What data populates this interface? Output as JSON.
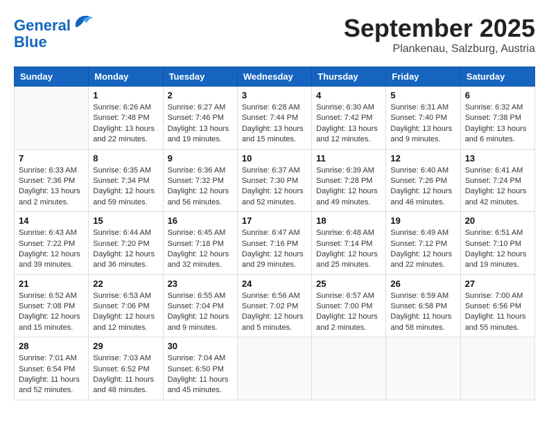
{
  "header": {
    "logo_line1": "General",
    "logo_line2": "Blue",
    "month_title": "September 2025",
    "location": "Plankenau, Salzburg, Austria"
  },
  "weekdays": [
    "Sunday",
    "Monday",
    "Tuesday",
    "Wednesday",
    "Thursday",
    "Friday",
    "Saturday"
  ],
  "weeks": [
    [
      {
        "day": "",
        "info": ""
      },
      {
        "day": "1",
        "info": "Sunrise: 6:26 AM\nSunset: 7:48 PM\nDaylight: 13 hours\nand 22 minutes."
      },
      {
        "day": "2",
        "info": "Sunrise: 6:27 AM\nSunset: 7:46 PM\nDaylight: 13 hours\nand 19 minutes."
      },
      {
        "day": "3",
        "info": "Sunrise: 6:28 AM\nSunset: 7:44 PM\nDaylight: 13 hours\nand 15 minutes."
      },
      {
        "day": "4",
        "info": "Sunrise: 6:30 AM\nSunset: 7:42 PM\nDaylight: 13 hours\nand 12 minutes."
      },
      {
        "day": "5",
        "info": "Sunrise: 6:31 AM\nSunset: 7:40 PM\nDaylight: 13 hours\nand 9 minutes."
      },
      {
        "day": "6",
        "info": "Sunrise: 6:32 AM\nSunset: 7:38 PM\nDaylight: 13 hours\nand 6 minutes."
      }
    ],
    [
      {
        "day": "7",
        "info": "Sunrise: 6:33 AM\nSunset: 7:36 PM\nDaylight: 13 hours\nand 2 minutes."
      },
      {
        "day": "8",
        "info": "Sunrise: 6:35 AM\nSunset: 7:34 PM\nDaylight: 12 hours\nand 59 minutes."
      },
      {
        "day": "9",
        "info": "Sunrise: 6:36 AM\nSunset: 7:32 PM\nDaylight: 12 hours\nand 56 minutes."
      },
      {
        "day": "10",
        "info": "Sunrise: 6:37 AM\nSunset: 7:30 PM\nDaylight: 12 hours\nand 52 minutes."
      },
      {
        "day": "11",
        "info": "Sunrise: 6:39 AM\nSunset: 7:28 PM\nDaylight: 12 hours\nand 49 minutes."
      },
      {
        "day": "12",
        "info": "Sunrise: 6:40 AM\nSunset: 7:26 PM\nDaylight: 12 hours\nand 46 minutes."
      },
      {
        "day": "13",
        "info": "Sunrise: 6:41 AM\nSunset: 7:24 PM\nDaylight: 12 hours\nand 42 minutes."
      }
    ],
    [
      {
        "day": "14",
        "info": "Sunrise: 6:43 AM\nSunset: 7:22 PM\nDaylight: 12 hours\nand 39 minutes."
      },
      {
        "day": "15",
        "info": "Sunrise: 6:44 AM\nSunset: 7:20 PM\nDaylight: 12 hours\nand 36 minutes."
      },
      {
        "day": "16",
        "info": "Sunrise: 6:45 AM\nSunset: 7:18 PM\nDaylight: 12 hours\nand 32 minutes."
      },
      {
        "day": "17",
        "info": "Sunrise: 6:47 AM\nSunset: 7:16 PM\nDaylight: 12 hours\nand 29 minutes."
      },
      {
        "day": "18",
        "info": "Sunrise: 6:48 AM\nSunset: 7:14 PM\nDaylight: 12 hours\nand 25 minutes."
      },
      {
        "day": "19",
        "info": "Sunrise: 6:49 AM\nSunset: 7:12 PM\nDaylight: 12 hours\nand 22 minutes."
      },
      {
        "day": "20",
        "info": "Sunrise: 6:51 AM\nSunset: 7:10 PM\nDaylight: 12 hours\nand 19 minutes."
      }
    ],
    [
      {
        "day": "21",
        "info": "Sunrise: 6:52 AM\nSunset: 7:08 PM\nDaylight: 12 hours\nand 15 minutes."
      },
      {
        "day": "22",
        "info": "Sunrise: 6:53 AM\nSunset: 7:06 PM\nDaylight: 12 hours\nand 12 minutes."
      },
      {
        "day": "23",
        "info": "Sunrise: 6:55 AM\nSunset: 7:04 PM\nDaylight: 12 hours\nand 9 minutes."
      },
      {
        "day": "24",
        "info": "Sunrise: 6:56 AM\nSunset: 7:02 PM\nDaylight: 12 hours\nand 5 minutes."
      },
      {
        "day": "25",
        "info": "Sunrise: 6:57 AM\nSunset: 7:00 PM\nDaylight: 12 hours\nand 2 minutes."
      },
      {
        "day": "26",
        "info": "Sunrise: 6:59 AM\nSunset: 6:58 PM\nDaylight: 11 hours\nand 58 minutes."
      },
      {
        "day": "27",
        "info": "Sunrise: 7:00 AM\nSunset: 6:56 PM\nDaylight: 11 hours\nand 55 minutes."
      }
    ],
    [
      {
        "day": "28",
        "info": "Sunrise: 7:01 AM\nSunset: 6:54 PM\nDaylight: 11 hours\nand 52 minutes."
      },
      {
        "day": "29",
        "info": "Sunrise: 7:03 AM\nSunset: 6:52 PM\nDaylight: 11 hours\nand 48 minutes."
      },
      {
        "day": "30",
        "info": "Sunrise: 7:04 AM\nSunset: 6:50 PM\nDaylight: 11 hours\nand 45 minutes."
      },
      {
        "day": "",
        "info": ""
      },
      {
        "day": "",
        "info": ""
      },
      {
        "day": "",
        "info": ""
      },
      {
        "day": "",
        "info": ""
      }
    ]
  ]
}
